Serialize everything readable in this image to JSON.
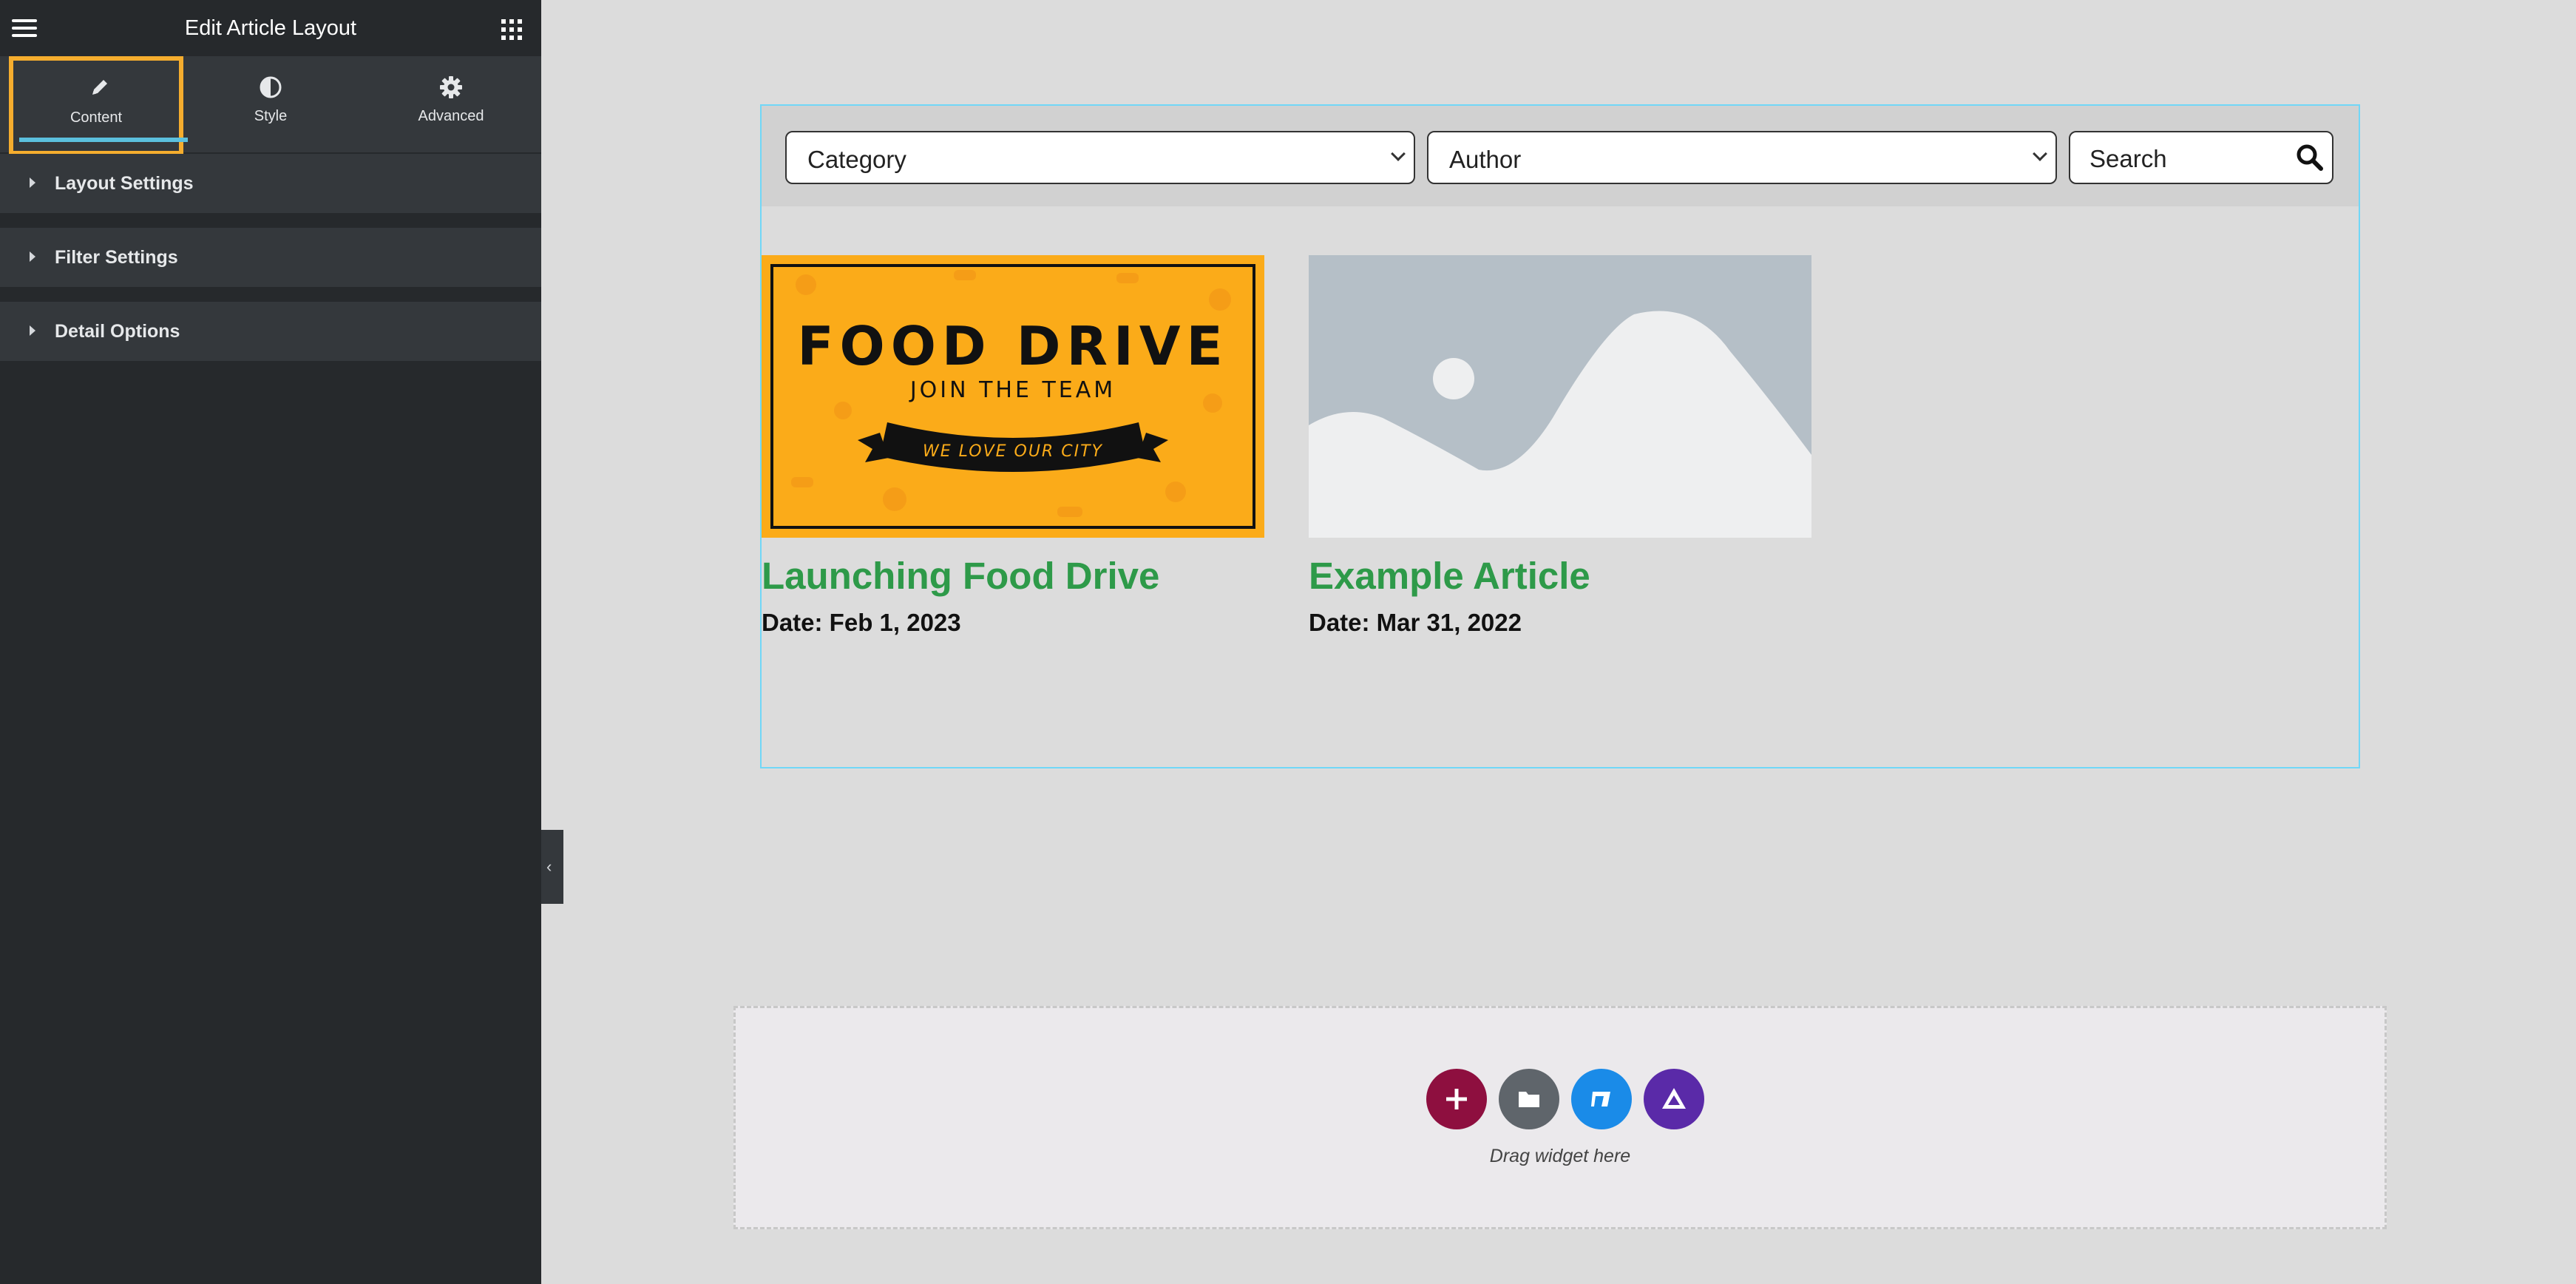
{
  "editor": {
    "title": "Edit Article Layout",
    "tabs": [
      {
        "label": "Content",
        "icon": "pencil-icon",
        "active": true
      },
      {
        "label": "Style",
        "icon": "contrast-icon",
        "active": false
      },
      {
        "label": "Advanced",
        "icon": "gear-icon",
        "active": false
      }
    ],
    "sections": [
      {
        "label": "Layout Settings"
      },
      {
        "label": "Filter Settings"
      },
      {
        "label": "Detail Options"
      }
    ],
    "highlight_color": "#f5ad2e",
    "tab_underline_color": "#5bc0de"
  },
  "filters": {
    "category": "Category",
    "author": "Author",
    "search_placeholder": "Search"
  },
  "articles": [
    {
      "title": "Launching Food Drive",
      "date": "Date: Feb 1, 2023",
      "image": {
        "headline": "FOOD DRIVE",
        "subline": "JOIN THE TEAM",
        "ribbon": "WE LOVE OUR CITY",
        "background_color": "#fbab19"
      }
    },
    {
      "title": "Example Article",
      "date": "Date: Mar 31, 2022",
      "image": {
        "placeholder": true,
        "background_color": "#b5bfc7"
      }
    }
  ],
  "title_color": "#2e9a49",
  "dropzone": {
    "text": "Drag widget here",
    "buttons": [
      {
        "icon": "plus-icon",
        "color": "#8e0f3f"
      },
      {
        "icon": "folder-icon",
        "color": "#5f656b"
      },
      {
        "icon": "flag-icon",
        "color": "#1a8be8"
      },
      {
        "icon": "triangle-logo-icon",
        "color": "#5a2aa8"
      }
    ]
  }
}
